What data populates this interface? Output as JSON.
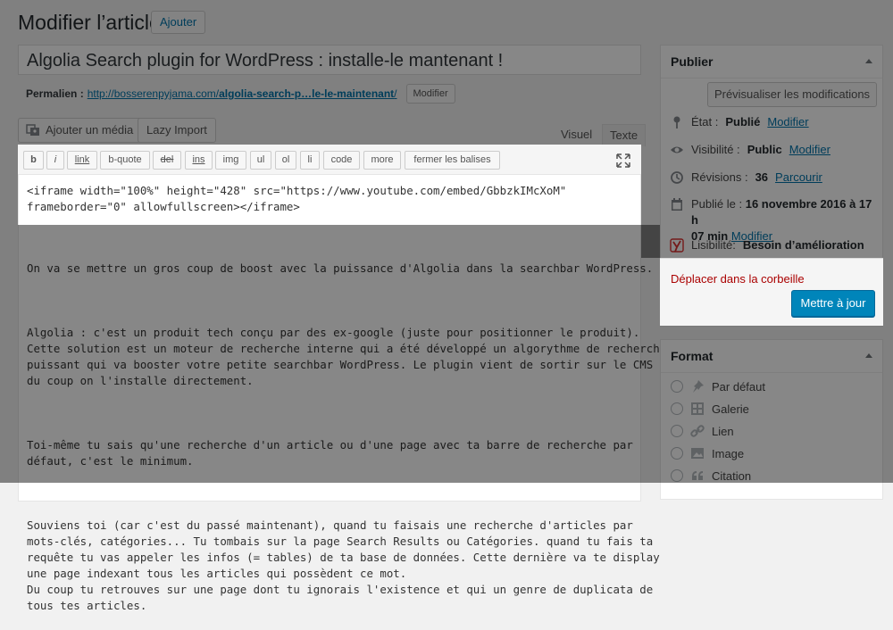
{
  "header": {
    "title": "Modifier l’article",
    "add_label": "Ajouter"
  },
  "post": {
    "title": "Algolia Search plugin for WordPress : installe-le mantenant !"
  },
  "permalink": {
    "label": "Permalien :",
    "url_base": "http://bosserenpyjama.com/",
    "url_slug": "algolia-search-p…le-le-maintenant",
    "url_end": "/",
    "edit_label": "Modifier"
  },
  "toolbar": {
    "add_media_label": "Ajouter un média",
    "lazy_import_label": "Lazy Import",
    "tab_visual": "Visuel",
    "tab_text": "Texte",
    "quicktags": [
      "b",
      "i",
      "link",
      "b-quote",
      "del",
      "ins",
      "img",
      "ul",
      "ol",
      "li",
      "code",
      "more",
      "fermer les balises"
    ]
  },
  "editor": {
    "iframe_lines": [
      "<iframe width=\"100%\" height=\"428\" src=\"https://www.youtube.com/embed/GbbzkIMcXoM\"",
      "frameborder=\"0\" allowfullscreen></iframe>"
    ],
    "paragraphs": [
      "On va se mettre un gros coup de boost avec la puissance d'Algolia dans la searchbar WordPress.",
      "Algolia : c'est un produit tech conçu par des ex-google (juste pour positionner le produit).\nCette solution est un moteur de recherche interne qui a été développé un algorythme de recherche\npuissant qui va booster votre petite searchbar WordPress. Le plugin vient de sortir sur le CMS\ndu coup on l'installe directement.",
      "Toi-même tu sais qu'une recherche d'un article ou d'une page avec ta barre de recherche par\ndéfaut, c'est le minimum.",
      "Souviens toi (car c'est du passé maintenant), quand tu faisais une recherche d'articles par\nmots-clés, catégories... Tu tombais sur la page Search Results ou Catégories. quand tu fais ta\nrequête tu vas appeler les infos (= tables) de ta base de données. Cette dernière va te display\nune page indexant tous les articles qui possèdent ce mot.\nDu coup tu retrouves sur une page dont tu ignorais l'existence et qui un genre de duplicata de\ntous tes articles."
    ]
  },
  "publish": {
    "title": "Publier",
    "preview_label": "Prévisualiser les modifications",
    "status_label": "État :",
    "status_value": "Publié",
    "visibility_label": "Visibilité :",
    "visibility_value": "Public",
    "revisions_label": "Révisions :",
    "revisions_value": "36",
    "revisions_link": "Parcourir",
    "published_label": "Publié le :",
    "published_value_1": "16 novembre 2016 à 17 h",
    "published_value_2": "07 min",
    "modify_label": "Modifier",
    "readability_label": "Lisibilité:",
    "readability_value": "Besoin d’amélioration",
    "trash_label": "Déplacer dans la corbeille",
    "update_label": "Mettre à jour"
  },
  "format": {
    "title": "Format",
    "options": [
      "Par défaut",
      "Galerie",
      "Lien",
      "Image",
      "Citation"
    ]
  },
  "colors": {
    "accent": "#0073aa",
    "primary_button": "#0085ba",
    "danger": "#a00",
    "yoast_red": "#dc3232"
  }
}
